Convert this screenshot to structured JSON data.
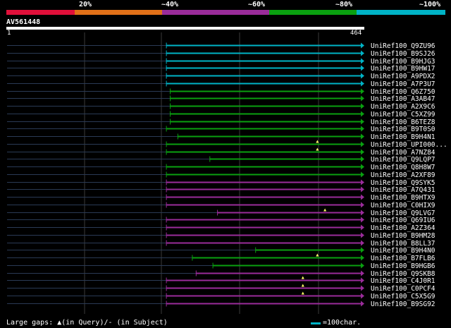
{
  "colors": {
    "bands": [
      "#e0103a",
      "#e07018",
      "#9a2c9a",
      "#0aa010",
      "#00b3c6"
    ],
    "background": "#000000",
    "guide": "#2a3a55",
    "grid": "#3a3a3a"
  },
  "header": {
    "thresholds": [
      "20%",
      "~40%",
      "~60%",
      "~80%",
      "~100%"
    ],
    "query_id": "AV561448",
    "ruler_start": "1",
    "ruler_end": "464"
  },
  "query_length": 464,
  "hits": [
    {
      "name": "UniRef100_Q9ZU96",
      "start": 209,
      "color": "cyan"
    },
    {
      "name": "UniRef100_B9SJ26",
      "start": 209,
      "color": "cyan"
    },
    {
      "name": "UniRef100_B9HJG3",
      "start": 209,
      "color": "cyan"
    },
    {
      "name": "UniRef100_B9HW17",
      "start": 209,
      "color": "cyan"
    },
    {
      "name": "UniRef100_A9PDX2",
      "start": 209,
      "color": "cyan"
    },
    {
      "name": "UniRef100_A7P3U7",
      "start": 209,
      "color": "cyan"
    },
    {
      "name": "UniRef100_Q6Z750",
      "start": 214,
      "color": "green"
    },
    {
      "name": "UniRef100_A3AB47",
      "start": 214,
      "color": "green"
    },
    {
      "name": "UniRef100_A2X9C6",
      "start": 214,
      "color": "green"
    },
    {
      "name": "UniRef100_C5XZ99",
      "start": 214,
      "color": "green"
    },
    {
      "name": "UniRef100_B6TEZ8",
      "start": 214,
      "color": "green"
    },
    {
      "name": "UniRef100_B9T0S0",
      "start": 209,
      "color": "green"
    },
    {
      "name": "UniRef100_B9H4N1",
      "start": 224,
      "color": "green"
    },
    {
      "name": "UniRef100_UPI000...",
      "start": 209,
      "color": "green",
      "marker": 407
    },
    {
      "name": "UniRef100_A7NZ84",
      "start": 209,
      "color": "green",
      "marker": 407
    },
    {
      "name": "UniRef100_Q9LQP7",
      "start": 266,
      "color": "green"
    },
    {
      "name": "UniRef100_Q8H8W7",
      "start": 209,
      "color": "green"
    },
    {
      "name": "UniRef100_A2XF89",
      "start": 209,
      "color": "green"
    },
    {
      "name": "UniRef100_Q9SYK5",
      "start": 209,
      "color": "purple"
    },
    {
      "name": "UniRef100_A7Q431",
      "start": 209,
      "color": "purple"
    },
    {
      "name": "UniRef100_B9HTX9",
      "start": 209,
      "color": "purple"
    },
    {
      "name": "UniRef100_C0HIX9",
      "start": 209,
      "color": "purple"
    },
    {
      "name": "UniRef100_Q9LVG7",
      "start": 276,
      "color": "purple",
      "marker": 417
    },
    {
      "name": "UniRef100_Q69IU6",
      "start": 209,
      "color": "purple"
    },
    {
      "name": "UniRef100_A2Z364",
      "start": 209,
      "color": "purple"
    },
    {
      "name": "UniRef100_B9HM28",
      "start": 209,
      "color": "purple"
    },
    {
      "name": "UniRef100_B8LL37",
      "start": 209,
      "color": "purple"
    },
    {
      "name": "UniRef100_B9H4N0",
      "start": 326,
      "color": "green"
    },
    {
      "name": "UniRef100_B7FLB6",
      "start": 243,
      "color": "green",
      "marker": 407
    },
    {
      "name": "UniRef100_B9HGB6",
      "start": 270,
      "color": "green"
    },
    {
      "name": "UniRef100_Q9SKB8",
      "start": 248,
      "color": "purple"
    },
    {
      "name": "UniRef100_C4J0R1",
      "start": 209,
      "color": "purple",
      "marker": 388
    },
    {
      "name": "UniRef100_C0PCF4",
      "start": 209,
      "color": "purple",
      "marker": 388
    },
    {
      "name": "UniRef100_C5X5G9",
      "start": 209,
      "color": "purple",
      "marker": 388
    },
    {
      "name": "UniRef100_B9SG92",
      "start": 209,
      "color": "purple"
    }
  ],
  "legend": {
    "gaps_text": "Large gaps: ▲(in Query)/- (in Subject)",
    "scale_text": "=100char."
  }
}
